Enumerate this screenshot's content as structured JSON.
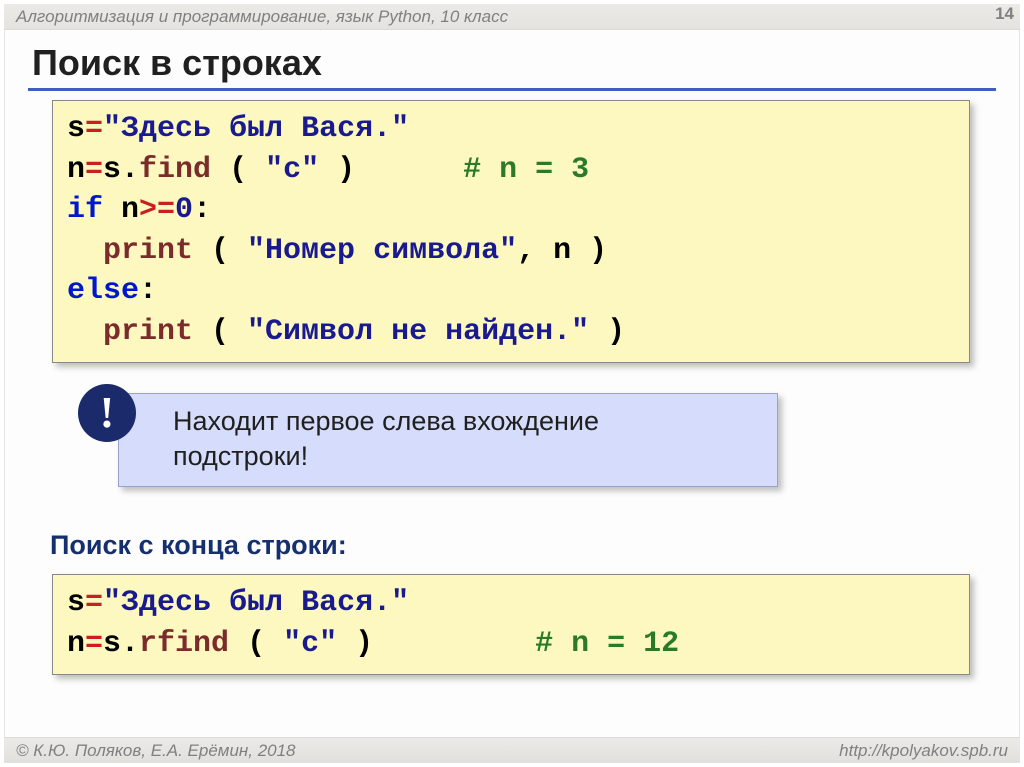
{
  "header": {
    "course": "Алгоритмизация и программирование, язык Python, 10 класс",
    "page": "14"
  },
  "title": "Поиск в строках",
  "code1": {
    "l1a": "s",
    "l1b": "=",
    "l1c": "\"Здесь был Вася.\"",
    "l2a": "n",
    "l2b": "=",
    "l2c": "s.",
    "l2d": "find",
    "l2e": " ( ",
    "l2f": "\"с\"",
    "l2g": " )      ",
    "l2h": "# n = 3",
    "l3a": "if",
    "l3b": " n",
    "l3c": ">=",
    "l3d": "0",
    "l3e": ":",
    "l4a": "  ",
    "l4b": "print",
    "l4c": " ( ",
    "l4d": "\"Номер символа\"",
    "l4e": ", n )",
    "l5a": "else",
    "l5b": ":",
    "l6a": "  ",
    "l6b": "print",
    "l6c": " ( ",
    "l6d": "\"Символ не найден.\"",
    "l6e": " )"
  },
  "note": {
    "bang": "!",
    "text_l1": "Находит первое слева вхождение",
    "text_l2": "подстроки!"
  },
  "subhead": "Поиск с конца строки:",
  "code2": {
    "l1a": "s",
    "l1b": "=",
    "l1c": "\"Здесь был Вася.\"",
    "l2a": "n",
    "l2b": "=",
    "l2c": "s.",
    "l2d": "rfind",
    "l2e": " ( ",
    "l2f": "\"с\"",
    "l2g": " )         ",
    "l2h": "# n = 12"
  },
  "footer": {
    "left": "© К.Ю. Поляков, Е.А. Ерёмин, 2018",
    "right": "http://kpolyakov.spb.ru"
  }
}
